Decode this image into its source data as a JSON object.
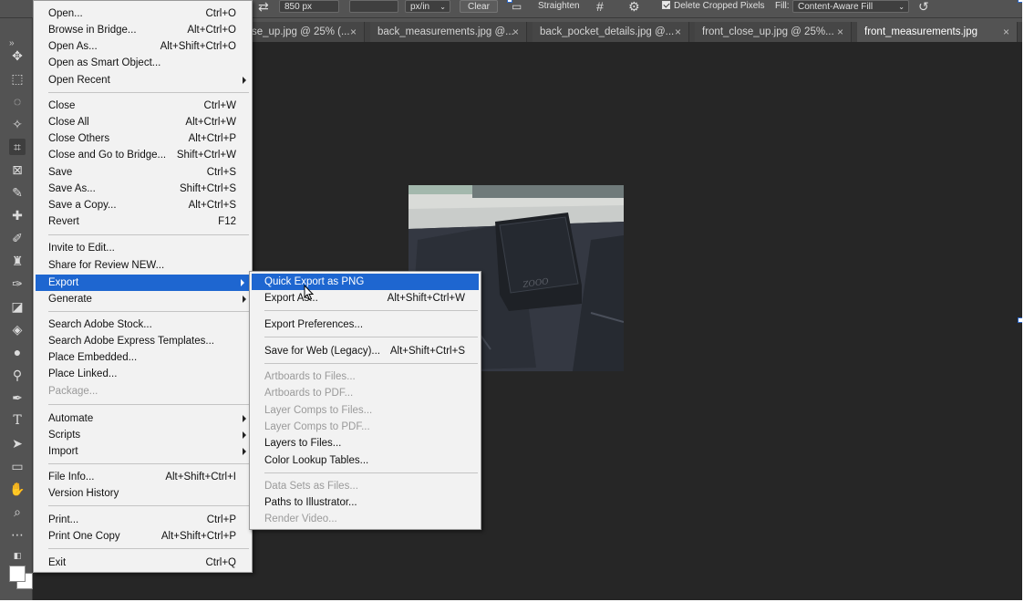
{
  "options_bar": {
    "ratio_value": "850 px",
    "resolution_value": "",
    "unit": "px/in",
    "clear_label": "Clear",
    "straighten_label": "Straighten",
    "delete_cropped_label": "Delete Cropped Pixels",
    "fill_label": "Fill:",
    "fill_value": "Content-Aware Fill"
  },
  "tabs": [
    {
      "label": "se_up.jpg @ 25% (...",
      "close": "×"
    },
    {
      "label": "back_measurements.jpg @...",
      "close": "×"
    },
    {
      "label": "back_pocket_details.jpg @...",
      "close": "×"
    },
    {
      "label": "front_close_up.jpg @ 25%...",
      "close": "×"
    },
    {
      "label": "front_measurements.jpg",
      "close": "×"
    }
  ],
  "file_menu": {
    "items": [
      {
        "label": "Open...",
        "shortcut": "Ctrl+O"
      },
      {
        "label": "Browse in Bridge...",
        "shortcut": "Alt+Ctrl+O"
      },
      {
        "label": "Open As...",
        "shortcut": "Alt+Shift+Ctrl+O"
      },
      {
        "label": "Open as Smart Object...",
        "shortcut": ""
      },
      {
        "label": "Open Recent",
        "shortcut": ""
      },
      {
        "label": "Close",
        "shortcut": "Ctrl+W"
      },
      {
        "label": "Close All",
        "shortcut": "Alt+Ctrl+W"
      },
      {
        "label": "Close Others",
        "shortcut": "Alt+Ctrl+P"
      },
      {
        "label": "Close and Go to Bridge...",
        "shortcut": "Shift+Ctrl+W"
      },
      {
        "label": "Save",
        "shortcut": "Ctrl+S"
      },
      {
        "label": "Save As...",
        "shortcut": "Shift+Ctrl+S"
      },
      {
        "label": "Save a Copy...",
        "shortcut": "Alt+Ctrl+S"
      },
      {
        "label": "Revert",
        "shortcut": "F12"
      },
      {
        "label": "Invite to Edit...",
        "shortcut": ""
      },
      {
        "label": "Share for Review NEW...",
        "shortcut": ""
      },
      {
        "label": "Export",
        "shortcut": ""
      },
      {
        "label": "Generate",
        "shortcut": ""
      },
      {
        "label": "Search Adobe Stock...",
        "shortcut": ""
      },
      {
        "label": "Search Adobe Express Templates...",
        "shortcut": ""
      },
      {
        "label": "Place Embedded...",
        "shortcut": ""
      },
      {
        "label": "Place Linked...",
        "shortcut": ""
      },
      {
        "label": "Package...",
        "shortcut": ""
      },
      {
        "label": "Automate",
        "shortcut": ""
      },
      {
        "label": "Scripts",
        "shortcut": ""
      },
      {
        "label": "Import",
        "shortcut": ""
      },
      {
        "label": "File Info...",
        "shortcut": "Alt+Shift+Ctrl+I"
      },
      {
        "label": "Version History",
        "shortcut": ""
      },
      {
        "label": "Print...",
        "shortcut": "Ctrl+P"
      },
      {
        "label": "Print One Copy",
        "shortcut": "Alt+Shift+Ctrl+P"
      },
      {
        "label": "Exit",
        "shortcut": "Ctrl+Q"
      }
    ]
  },
  "export_submenu": {
    "items": [
      {
        "label": "Quick Export as PNG",
        "shortcut": ""
      },
      {
        "label": "Export As...",
        "shortcut": "Alt+Shift+Ctrl+W"
      },
      {
        "label": "Export Preferences...",
        "shortcut": ""
      },
      {
        "label": "Save for Web (Legacy)...",
        "shortcut": "Alt+Shift+Ctrl+S"
      },
      {
        "label": "Artboards to Files...",
        "shortcut": ""
      },
      {
        "label": "Artboards to PDF...",
        "shortcut": ""
      },
      {
        "label": "Layer Comps to Files...",
        "shortcut": ""
      },
      {
        "label": "Layer Comps to PDF...",
        "shortcut": ""
      },
      {
        "label": "Layers to Files...",
        "shortcut": ""
      },
      {
        "label": "Color Lookup Tables...",
        "shortcut": ""
      },
      {
        "label": "Data Sets as Files...",
        "shortcut": ""
      },
      {
        "label": "Paths to Illustrator...",
        "shortcut": ""
      },
      {
        "label": "Render Video...",
        "shortcut": ""
      }
    ]
  },
  "canvas": {
    "patch_text": "ZOOO"
  },
  "colors": {
    "menu_highlight": "#1e66d0",
    "canvas_bg": "#262626",
    "chrome_bg": "#535353",
    "selection_handle": "#2a66c8"
  }
}
